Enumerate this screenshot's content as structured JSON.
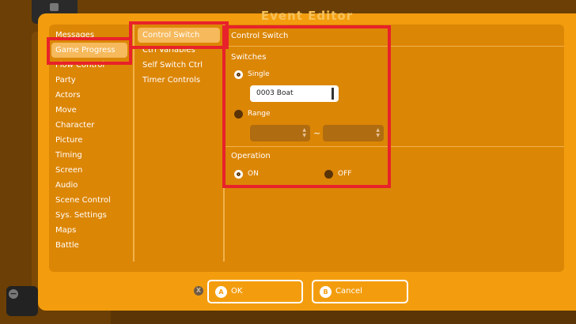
{
  "window": {
    "title": "Event Editor"
  },
  "categories": [
    "Messages",
    "Game Progress",
    "Flow Control",
    "Party",
    "Actors",
    "Move",
    "Character",
    "Picture",
    "Timing",
    "Screen",
    "Audio",
    "Scene Control",
    "Sys. Settings",
    "Maps",
    "Battle"
  ],
  "selected_category": "Game Progress",
  "commands": [
    "Control Switch",
    "Ctrl Variables",
    "Self Switch Ctrl",
    "Timer Controls"
  ],
  "selected_command": "Control Switch",
  "detail": {
    "title": "Control Switch",
    "switches_heading": "Switches",
    "single_label": "Single",
    "single_value": "0003 Boat",
    "range_label": "Range",
    "range_separator": "~",
    "operation_heading": "Operation",
    "on_label": "ON",
    "off_label": "OFF",
    "selected_target": "Single",
    "selected_operation": "ON"
  },
  "footer": {
    "close_glyph": "X",
    "ok_glyph": "A",
    "ok_label": "OK",
    "cancel_glyph": "B",
    "cancel_label": "Cancel"
  },
  "colors": {
    "window": "#f39d0e",
    "panel": "#dc8606",
    "selection": "#f6b95b",
    "highlight": "#e8222a"
  }
}
